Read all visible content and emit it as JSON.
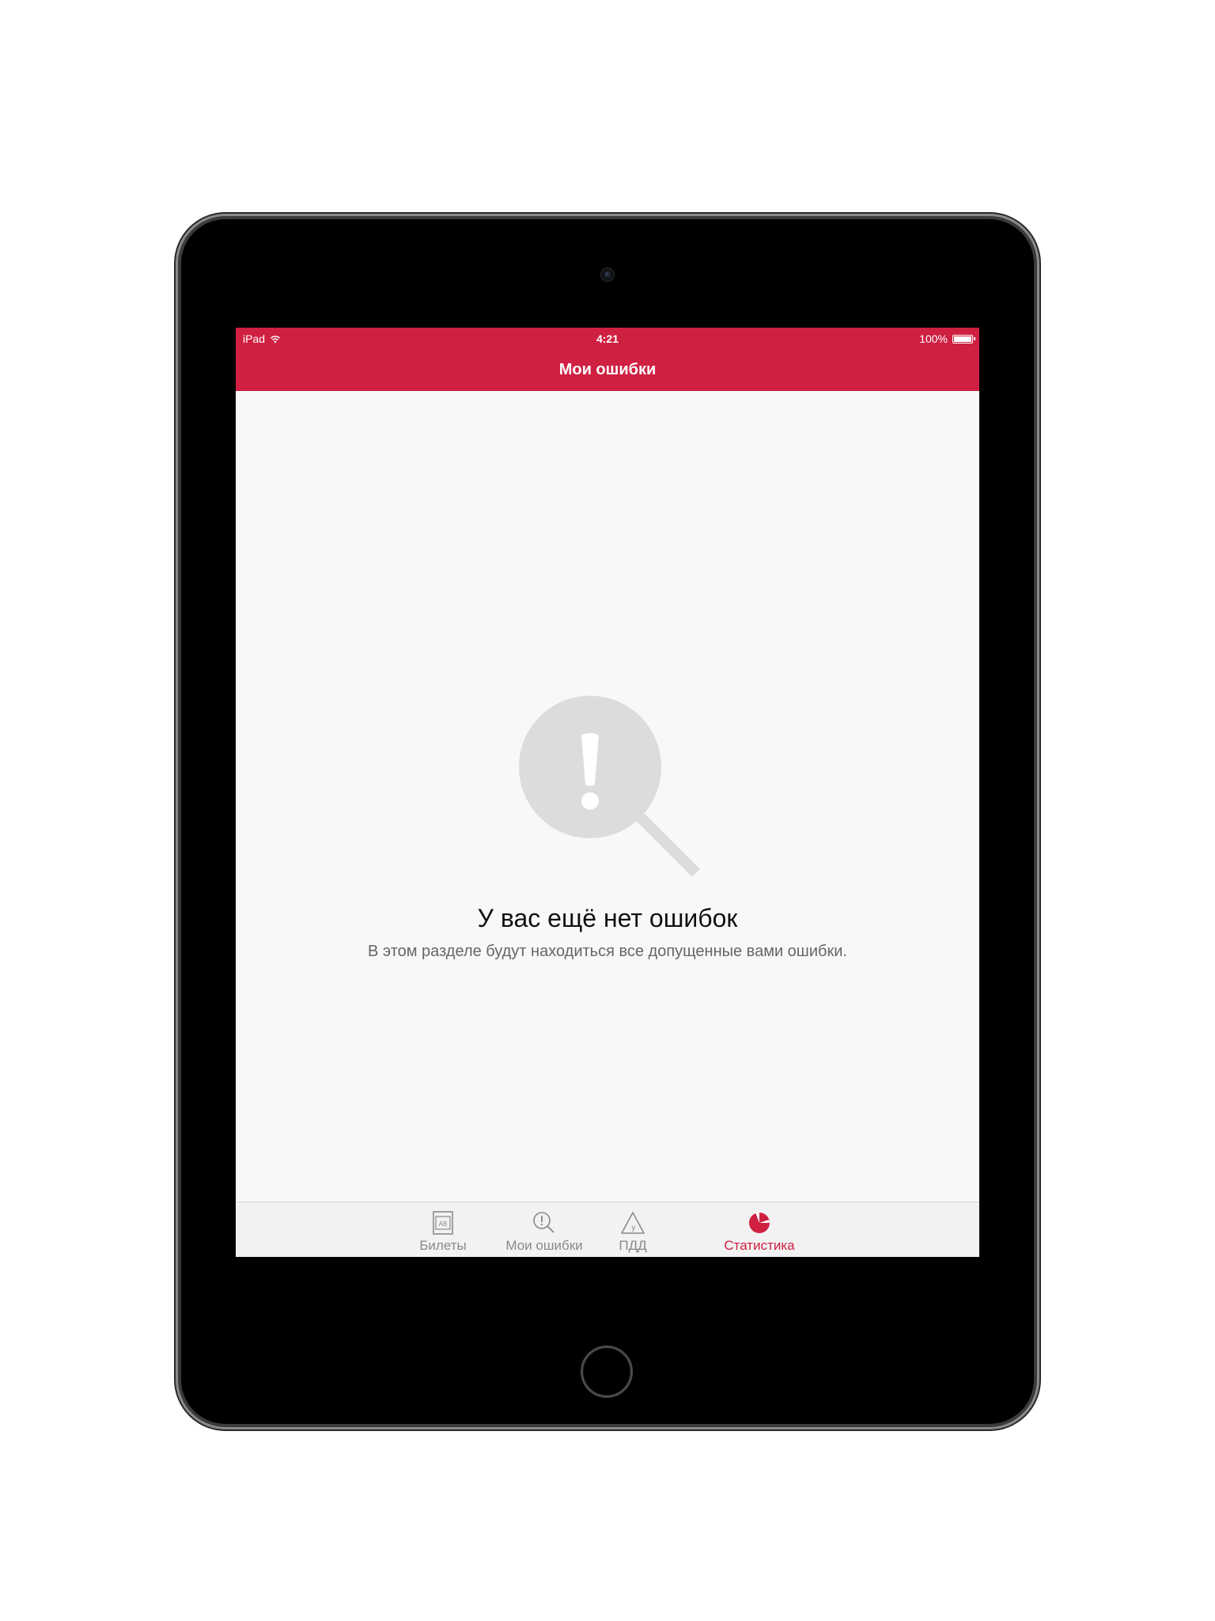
{
  "status_bar": {
    "device": "iPad",
    "time": "4:21",
    "battery": "100%"
  },
  "nav": {
    "title": "Мои ошибки"
  },
  "empty_state": {
    "icon": "magnifier-exclamation-icon",
    "title": "У вас ещё нет ошибок",
    "subtitle": "В этом разделе будут находиться все допущенные вами ошибки."
  },
  "tabbar": {
    "items": [
      {
        "label": "Билеты",
        "icon": "tickets-icon",
        "icon_text": "AB",
        "active": false
      },
      {
        "label": "Мои ошибки",
        "icon": "my-errors-icon",
        "active": false
      },
      {
        "label": "ПДД",
        "icon": "traffic-rules-icon",
        "icon_text": "у",
        "active": false
      },
      {
        "label": "Статистика",
        "icon": "statistics-icon",
        "active": true
      }
    ]
  },
  "colors": {
    "accent": "#cf2042",
    "background": "#f8f8f8",
    "tab_inactive": "#8a8a8a",
    "empty_icon": "#dcdcdc"
  }
}
